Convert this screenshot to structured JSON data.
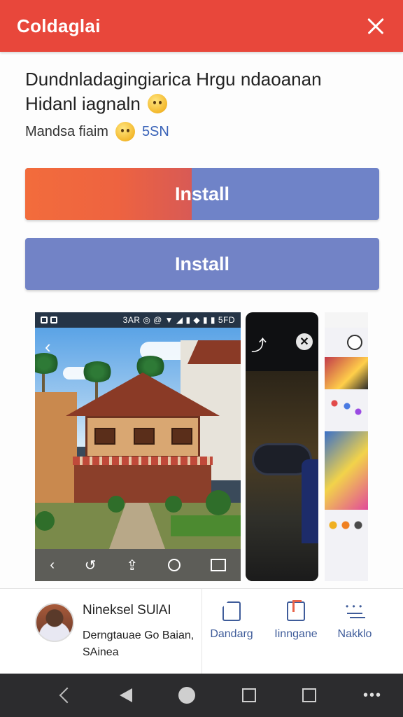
{
  "header": {
    "title": "Coldaglai"
  },
  "app": {
    "description_line1": "Dundnladagingiarica Hrgu ndaoanan",
    "description_line2": "Hidanl iagnaln",
    "rating_label": "Mandsa fiaim",
    "rating_count": "5SN"
  },
  "buttons": {
    "install_primary": "Install",
    "install_primary_progress": 0.47,
    "install_secondary": "Install"
  },
  "screenshot1": {
    "status_text": "3AR ◎ @ ▼ ◢ ▮ ◆ ▮ ▮ 5FD"
  },
  "developer": {
    "name": "Nineksel SUlAI",
    "line1": "Derngtauae Go Baian,",
    "line2": "SAinea"
  },
  "actions": [
    {
      "label": "Dandarg",
      "icon": "document-icon"
    },
    {
      "label": "Iinngane",
      "icon": "file-share-icon"
    },
    {
      "label": "Nakklo",
      "icon": "more-icon"
    }
  ],
  "colors": {
    "header": "#e8473b",
    "install_blue": "#6f83c8",
    "install_orange": "#f26c3c",
    "link_blue": "#3f5c9a"
  }
}
